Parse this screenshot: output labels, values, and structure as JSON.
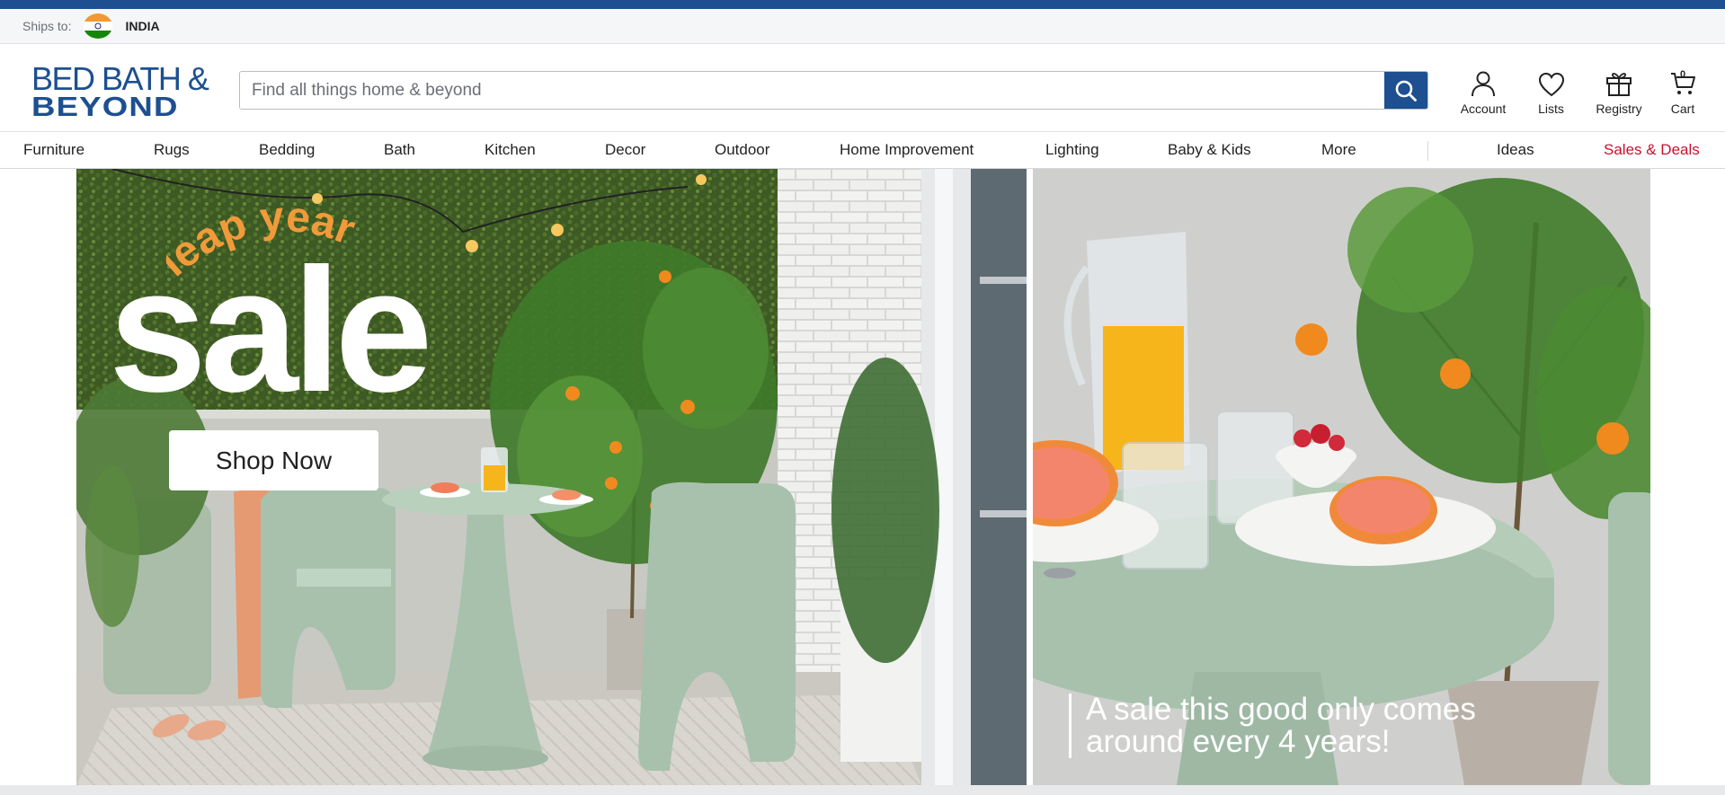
{
  "ships_bar": {
    "label": "Ships to:",
    "country": "INDIA",
    "flag_icon": "india-flag-icon"
  },
  "header": {
    "logo": {
      "line1": "BED BATH &",
      "line2": "BEYOND"
    },
    "search": {
      "placeholder": "Find all things home & beyond",
      "value": ""
    },
    "icons": {
      "account": {
        "label": "Account",
        "icon": "user-icon"
      },
      "lists": {
        "label": "Lists",
        "icon": "heart-icon"
      },
      "registry": {
        "label": "Registry",
        "icon": "gift-icon"
      },
      "cart": {
        "label": "Cart",
        "count": "0",
        "icon": "cart-icon"
      }
    }
  },
  "nav": {
    "items": [
      "Furniture",
      "Rugs",
      "Bedding",
      "Bath",
      "Kitchen",
      "Decor",
      "Outdoor",
      "Home Improvement",
      "Lighting",
      "Baby & Kids",
      "More"
    ],
    "ideas": "Ideas",
    "sales": "Sales & Deals"
  },
  "hero": {
    "script_text": "leap year",
    "headline": "sale",
    "cta": "Shop Now",
    "tagline_line1": "A sale this good only comes",
    "tagline_line2": "around every 4 years!"
  },
  "colors": {
    "brand_blue": "#1d4f91",
    "sale_red": "#c8102e",
    "script_orange": "#f29a3a"
  }
}
